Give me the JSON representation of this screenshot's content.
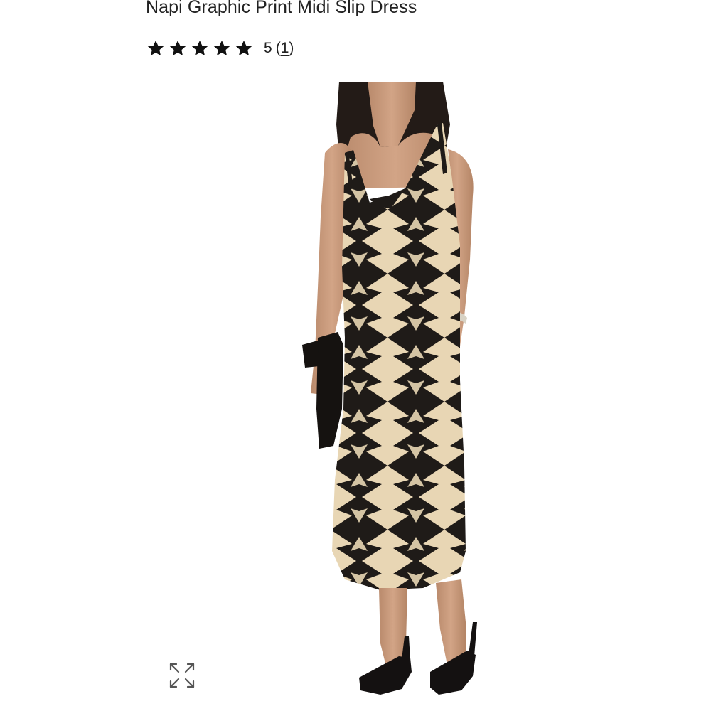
{
  "product": {
    "title": "Napi Graphic Print Midi Slip Dress",
    "rating": {
      "stars": 5,
      "max_stars": 5,
      "value_label": "5",
      "count_open": "(",
      "count": "1",
      "count_close": ")"
    },
    "image": {
      "icon": "product-photo",
      "expand_icon": "expand-arrows-icon"
    }
  },
  "colors": {
    "text": "#222222",
    "star": "#111111",
    "dress_dark": "#1f1b18",
    "dress_light": "#e8d6b4",
    "skin": "#c99a7c",
    "icon_gray": "#555555"
  }
}
